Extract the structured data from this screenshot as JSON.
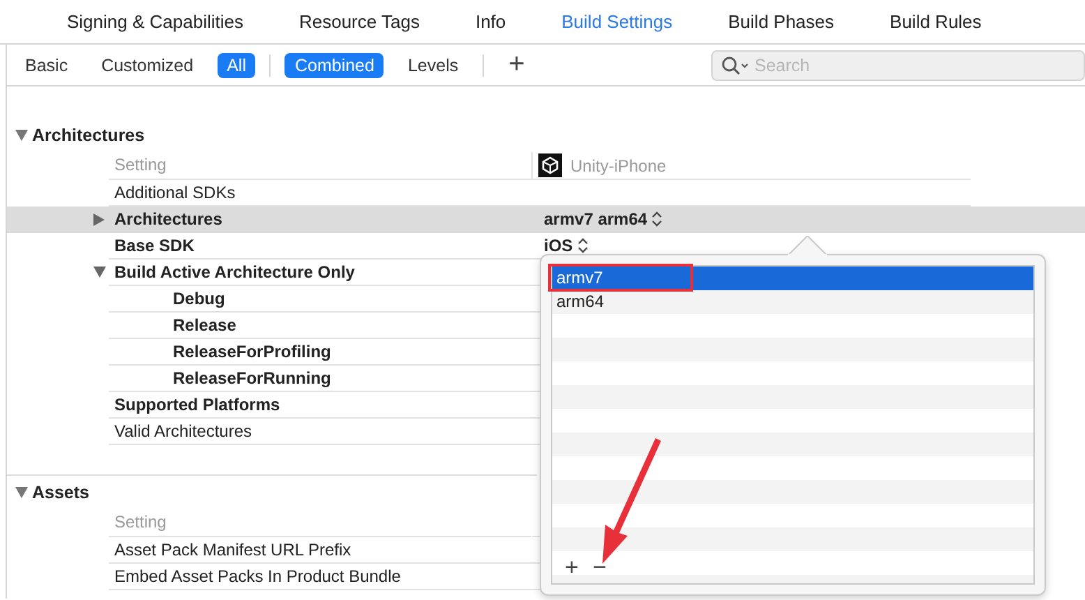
{
  "tabs": [
    {
      "label": "Signing & Capabilities",
      "selected": false
    },
    {
      "label": "Resource Tags",
      "selected": false
    },
    {
      "label": "Info",
      "selected": false
    },
    {
      "label": "Build Settings",
      "selected": true
    },
    {
      "label": "Build Phases",
      "selected": false
    },
    {
      "label": "Build Rules",
      "selected": false
    }
  ],
  "filter_bar": {
    "scope": [
      {
        "label": "Basic",
        "selected": false
      },
      {
        "label": "Customized",
        "selected": false
      },
      {
        "label": "All",
        "selected": true
      }
    ],
    "view": [
      {
        "label": "Combined",
        "selected": true
      },
      {
        "label": "Levels",
        "selected": false
      }
    ],
    "add_button": "+",
    "search": {
      "placeholder": "Search"
    }
  },
  "sections": [
    {
      "title": "Architectures",
      "expanded": true,
      "header": {
        "setting": "Setting",
        "target": "Unity-iPhone"
      },
      "rows": [
        {
          "name": "Additional SDKs",
          "modified": false,
          "selected": false
        },
        {
          "name": "Architectures",
          "modified": true,
          "selected": true,
          "expanded": false,
          "value": "armv7 arm64"
        },
        {
          "name": "Base SDK",
          "modified": true,
          "selected": false,
          "value": "iOS"
        },
        {
          "name": "Build Active Architecture Only",
          "modified": true,
          "selected": false,
          "expanded": true,
          "children": [
            {
              "name": "Debug",
              "modified": true,
              "selected": false
            },
            {
              "name": "Release",
              "modified": true,
              "selected": false
            },
            {
              "name": "ReleaseForProfiling",
              "modified": true,
              "selected": false
            },
            {
              "name": "ReleaseForRunning",
              "modified": true,
              "selected": false
            }
          ]
        },
        {
          "name": "Supported Platforms",
          "modified": true,
          "selected": false
        },
        {
          "name": "Valid Architectures",
          "modified": false,
          "selected": false
        }
      ]
    },
    {
      "title": "Assets",
      "expanded": true,
      "header": {
        "setting": "Setting"
      },
      "rows": [
        {
          "name": "Asset Pack Manifest URL Prefix",
          "modified": false,
          "selected": false
        },
        {
          "name": "Embed Asset Packs In Product Bundle",
          "modified": false,
          "selected": false
        }
      ]
    }
  ],
  "popover": {
    "items": [
      {
        "label": "armv7",
        "selected": true
      },
      {
        "label": "arm64",
        "selected": false
      }
    ],
    "add_button": "+",
    "remove_button": "−"
  }
}
